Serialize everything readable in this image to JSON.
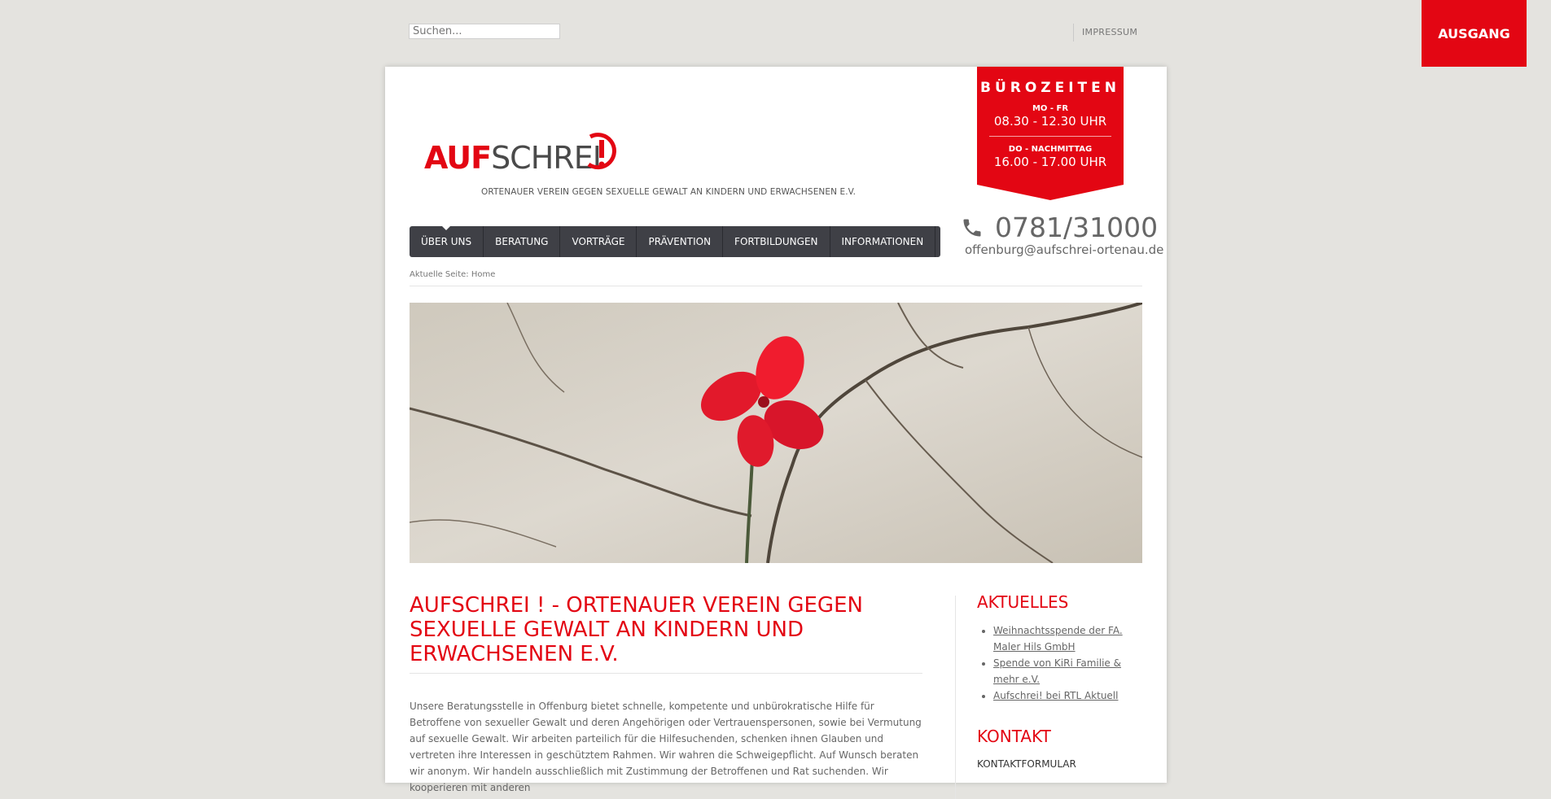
{
  "topbar": {
    "search_placeholder": "Suchen...",
    "impressum": "IMPRESSUM",
    "exit_label": "AUSGANG"
  },
  "logo": {
    "word_red": "AUF",
    "word_dark": "SCHREI",
    "subtitle": "ORTENAUER VEREIN GEGEN SEXUELLE GEWALT AN KINDERN UND ERWACHSENEN E.V."
  },
  "office": {
    "title": "BÜROZEITEN",
    "days1": "MO - FR",
    "time1": "08.30  -  12.30 UHR",
    "days2": "DO - NACHMITTAG",
    "time2": "16.00  -  17.00 UHR"
  },
  "contact": {
    "phone": "0781/31000",
    "email": "offenburg@aufschrei-ortenau.de"
  },
  "nav": {
    "items": [
      "ÜBER UNS",
      "BERATUNG",
      "VORTRÄGE",
      "PRÄVENTION",
      "FORTBILDUNGEN",
      "INFORMATIONEN"
    ]
  },
  "breadcrumb": "Aktuelle Seite: Home",
  "main": {
    "title": "AUFSCHREI ! - ORTENAUER VEREIN GEGEN SEXUELLE GEWALT AN KINDERN UND ERWACHSENEN E.V.",
    "intro": "Unsere Beratungsstelle in Offenburg bietet schnelle, kompetente und unbürokratische Hilfe für Betroffene von sexueller Gewalt und deren Angehörigen oder Vertrauenspersonen, sowie bei Vermutung auf sexuelle Gewalt. Wir arbeiten parteilich für die Hilfesuchenden, schenken ihnen Glauben und vertreten ihre Interessen in geschütztem Rahmen. Wir wahren die Schweigepflicht. Auf Wunsch beraten wir anonym. Wir handeln ausschließlich mit Zustimmung der Betroffenen und Rat suchenden. Wir kooperieren mit anderen"
  },
  "sidebar": {
    "news_title": "AKTUELLES",
    "news": [
      "Weihnachtsspende der FA. Maler Hils GmbH",
      "Spende von KiRi Familie & mehr e.V.",
      "Aufschrei! bei RTL Aktuell"
    ],
    "contact_title": "KONTAKT",
    "contact_link": "KONTAKTFORMULAR"
  },
  "colors": {
    "accent": "#e30613",
    "nav_bg": "#3f4046",
    "page_bg": "#e4e3df"
  }
}
